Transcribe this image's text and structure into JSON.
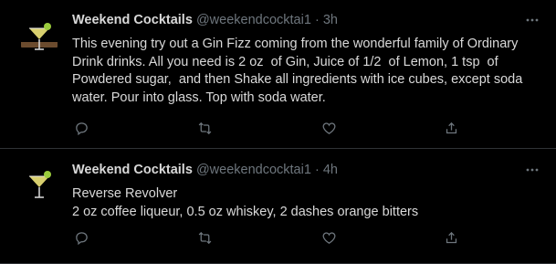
{
  "tweets": [
    {
      "author_name": "Weekend Cocktails",
      "handle": "@weekendcocktai1",
      "separator": "·",
      "time": "3h",
      "text": "This evening try out a Gin Fizz coming from the wonderful family of Ordinary Drink drinks. All you need is 2 oz  of Gin, Juice of 1/2  of Lemon, 1 tsp  of Powdered sugar,  and then Shake all ingredients with ice cubes, except soda water. Pour into glass. Top with soda water."
    },
    {
      "author_name": "Weekend Cocktails",
      "handle": "@weekendcocktai1",
      "separator": "·",
      "time": "4h",
      "text": "Reverse Revolver\n2 oz coffee liqueur, 0.5 oz whiskey, 2 dashes orange bitters"
    }
  ],
  "icons": {
    "more": "more-icon",
    "reply": "reply-icon",
    "retweet": "retweet-icon",
    "like": "like-icon",
    "share": "share-icon"
  },
  "colors": {
    "background": "#000000",
    "text": "#d9d9d9",
    "muted": "#6e767d",
    "divider": "#2f3336"
  }
}
